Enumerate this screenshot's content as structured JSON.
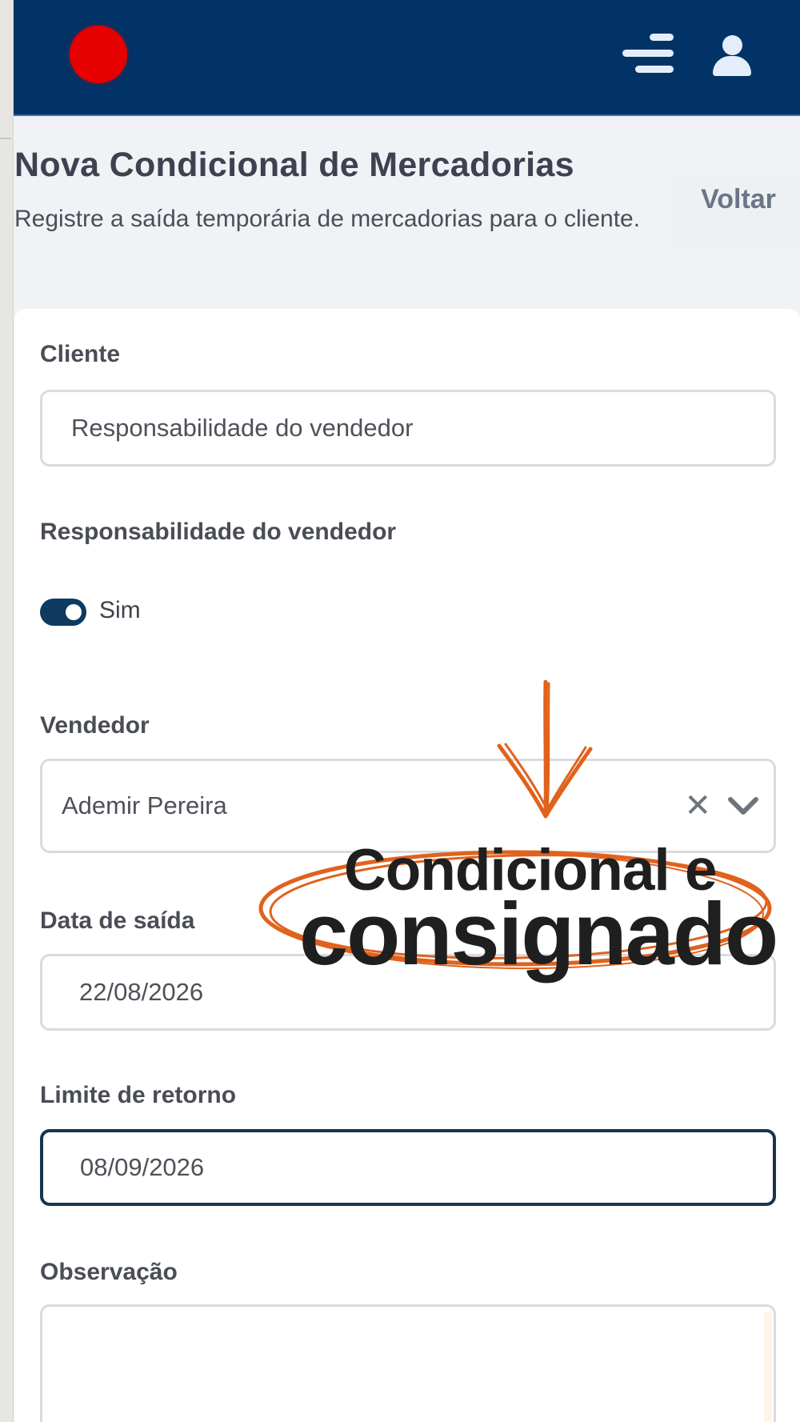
{
  "header": {
    "logo": "red-circle-logo",
    "menu_icon": "menu-icon",
    "user_icon": "user-icon"
  },
  "page": {
    "title": "Nova Condicional de Mercadorias",
    "subtitle": "Registre a saída temporária de mercadorias para o cliente.",
    "back_label": "Voltar"
  },
  "form": {
    "cliente": {
      "label": "Cliente",
      "value": "Responsabilidade do vendedor"
    },
    "responsabilidade": {
      "label": "Responsabilidade do vendedor",
      "toggle_label": "Sim",
      "checked": true
    },
    "vendedor": {
      "label": "Vendedor",
      "value": "Ademir Pereira"
    },
    "data_saida": {
      "label": "Data de saída",
      "value": "22/08/2026"
    },
    "limite_retorno": {
      "label": "Limite de retorno",
      "value": "08/09/2026"
    },
    "observacao": {
      "label": "Observação",
      "value": ""
    }
  },
  "overlay": {
    "line1": "Condicional e",
    "line2": "consignado",
    "accent_color": "#e0621d"
  },
  "colors": {
    "header_bg": "#023366",
    "logo": "#e60000",
    "toggle_on": "#0e3a5f"
  }
}
